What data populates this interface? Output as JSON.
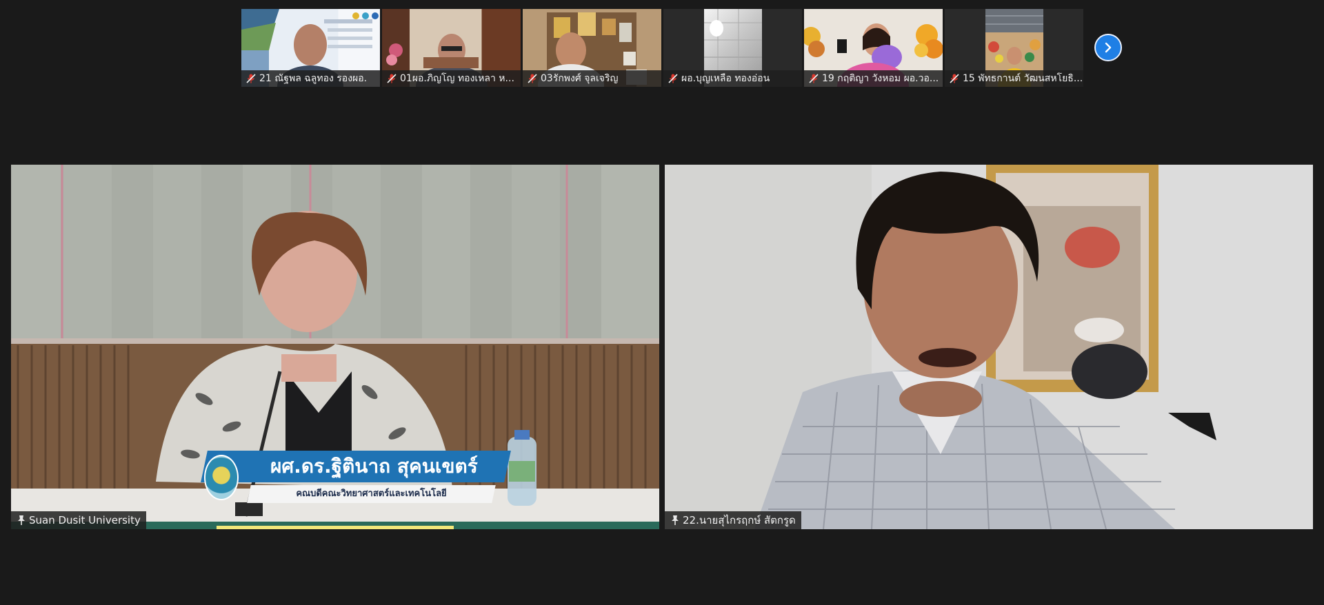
{
  "thumbnails": [
    {
      "name": "21 ณัฐพล ฉลูทอง รองผอ.",
      "video": "slide-presenter"
    },
    {
      "name": "01ผอ.ภิญโญ  ทองเหลา ห...",
      "video": "office-man"
    },
    {
      "name": "03รักพงศ์ จุลเจริญ",
      "video": "shelf-man"
    },
    {
      "name": "ผอ.บุญเหลือ ทองอ่อน",
      "video": "ceiling"
    },
    {
      "name": "19 กฤติญา วังหอม ผอ.วอ...",
      "video": "woman-flowers"
    },
    {
      "name": "15 พัทธกานต์ วัฒนสหโยธิ...",
      "video": "woman-room"
    }
  ],
  "next_page_icon": "chevron-right-icon",
  "main_tiles": [
    {
      "name": "Suan Dusit University",
      "lower_third": {
        "title": "ผศ.ดร.ฐิตินาถ สุคนเขตร์",
        "subtitle": "คณบดีคณะวิทยาศาสตร์และเทคโนโลยี"
      }
    },
    {
      "name": "22.นายสุไกรฤกษ์ สัตกรูด"
    }
  ],
  "colors": {
    "background": "#1a1a1a",
    "accent": "#1f7fe5",
    "mute": "#e0392e"
  }
}
